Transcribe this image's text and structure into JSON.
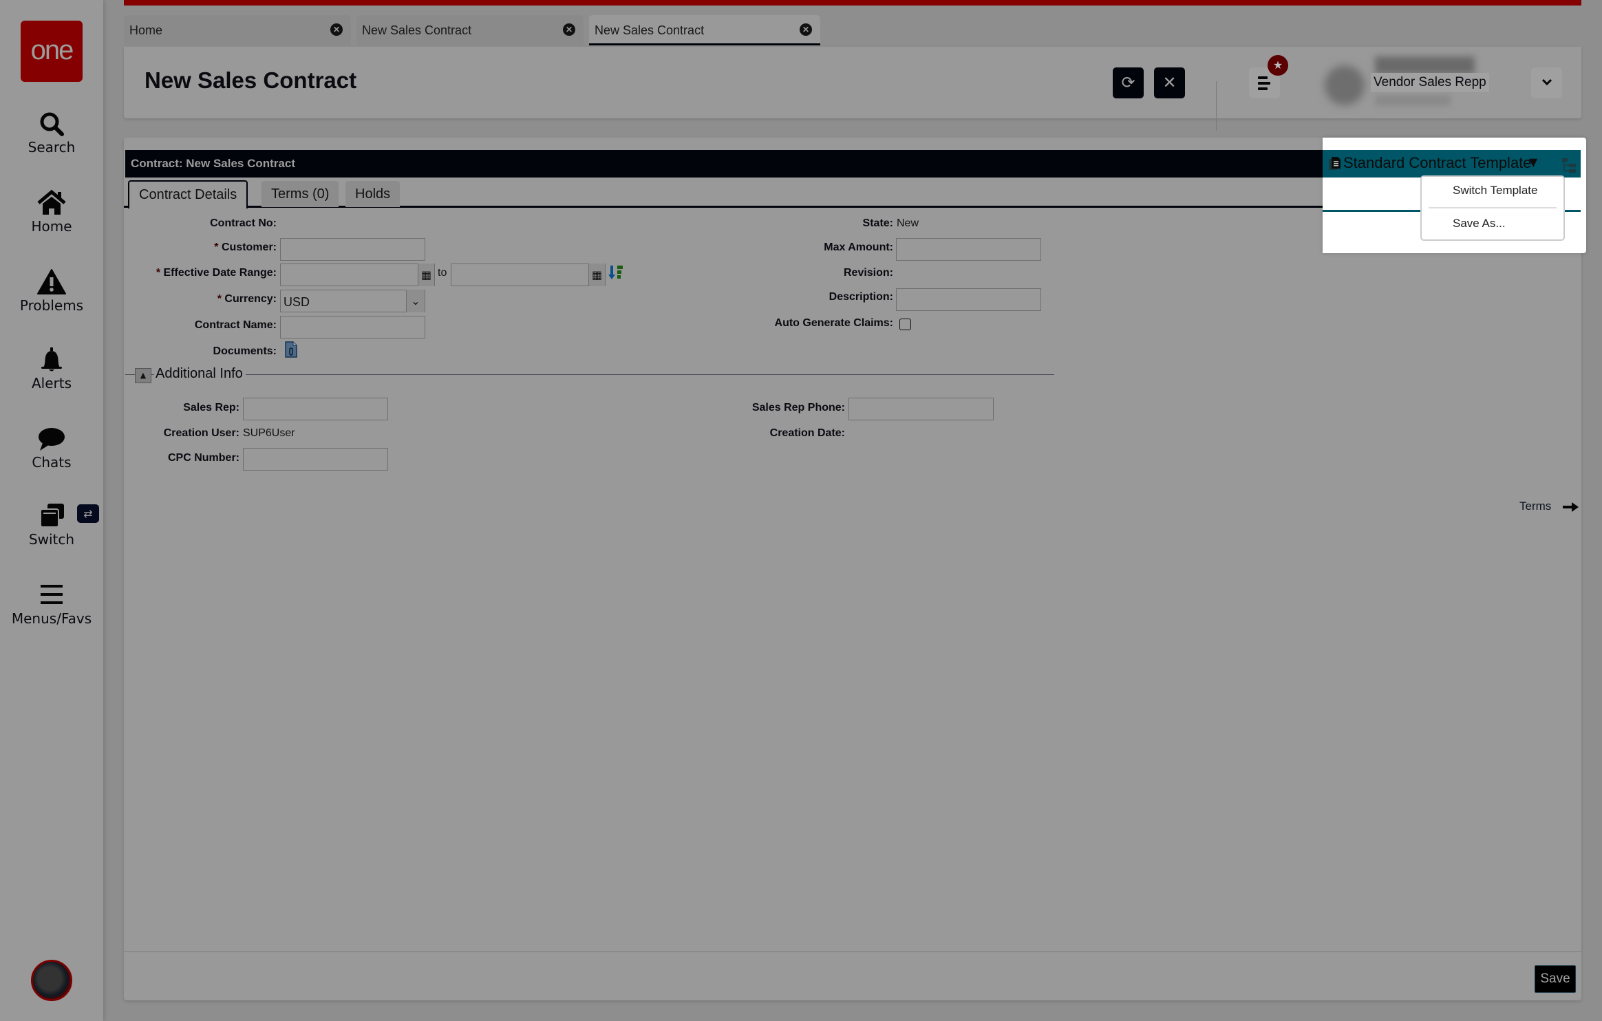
{
  "sidebar": {
    "logo": "one",
    "items": [
      {
        "label": "Search",
        "icon": "search-icon"
      },
      {
        "label": "Home",
        "icon": "home-icon"
      },
      {
        "label": "Problems",
        "icon": "warning-icon"
      },
      {
        "label": "Alerts",
        "icon": "bell-icon"
      },
      {
        "label": "Chats",
        "icon": "chat-icon"
      },
      {
        "label": "Switch",
        "icon": "windows-icon"
      },
      {
        "label": "Menus/Favs",
        "icon": "hamburger-icon"
      }
    ],
    "switch_badge": "⇄"
  },
  "tabs": [
    {
      "label": "Home",
      "active": false
    },
    {
      "label": "New Sales Contract",
      "active": false
    },
    {
      "label": "New Sales Contract",
      "active": true
    }
  ],
  "header": {
    "title": "New Sales Contract",
    "refresh_icon": "⟳",
    "close_icon": "✕",
    "fav_icon": "★",
    "user_role": "Vendor Sales Repp",
    "user_dropdown_icon": "⌄"
  },
  "contract": {
    "title_bar": "Contract: New Sales Contract",
    "template": {
      "label": "Standard Contract Template",
      "menu": [
        "Switch Template",
        "Save As..."
      ]
    },
    "tabs": [
      "Contract Details",
      "Terms (0)",
      "Holds"
    ],
    "fields_left": {
      "contract_no": {
        "label": "Contract No:",
        "value": ""
      },
      "customer": {
        "label": "Customer:",
        "value": ""
      },
      "effective_date_range": {
        "label": "Effective Date Range:",
        "from": "",
        "to_label": "to",
        "to": ""
      },
      "currency": {
        "label": "Currency:",
        "value": "USD"
      },
      "contract_name": {
        "label": "Contract Name:",
        "value": ""
      },
      "documents": {
        "label": "Documents:"
      }
    },
    "fields_right": {
      "state": {
        "label": "State:",
        "value": "New"
      },
      "max_amount": {
        "label": "Max Amount:",
        "value": ""
      },
      "revision": {
        "label": "Revision:",
        "value": ""
      },
      "description": {
        "label": "Description:",
        "value": ""
      },
      "auto_generate_claims": {
        "label": "Auto Generate Claims:",
        "checked": false
      }
    },
    "required_marker": "*",
    "additional_info": {
      "title": "Additional Info",
      "sales_rep": {
        "label": "Sales Rep:",
        "value": ""
      },
      "sales_rep_phone": {
        "label": "Sales Rep Phone:",
        "value": ""
      },
      "creation_user": {
        "label": "Creation User:",
        "value": "SUP6User"
      },
      "creation_date": {
        "label": "Creation Date:",
        "value": ""
      },
      "cpc_number": {
        "label": "CPC Number:",
        "value": ""
      }
    },
    "terms_link": "Terms",
    "save_label": "Save"
  },
  "colors": {
    "brand_red": "#850000",
    "template_teal": "#005566",
    "dark": "#02040c"
  }
}
